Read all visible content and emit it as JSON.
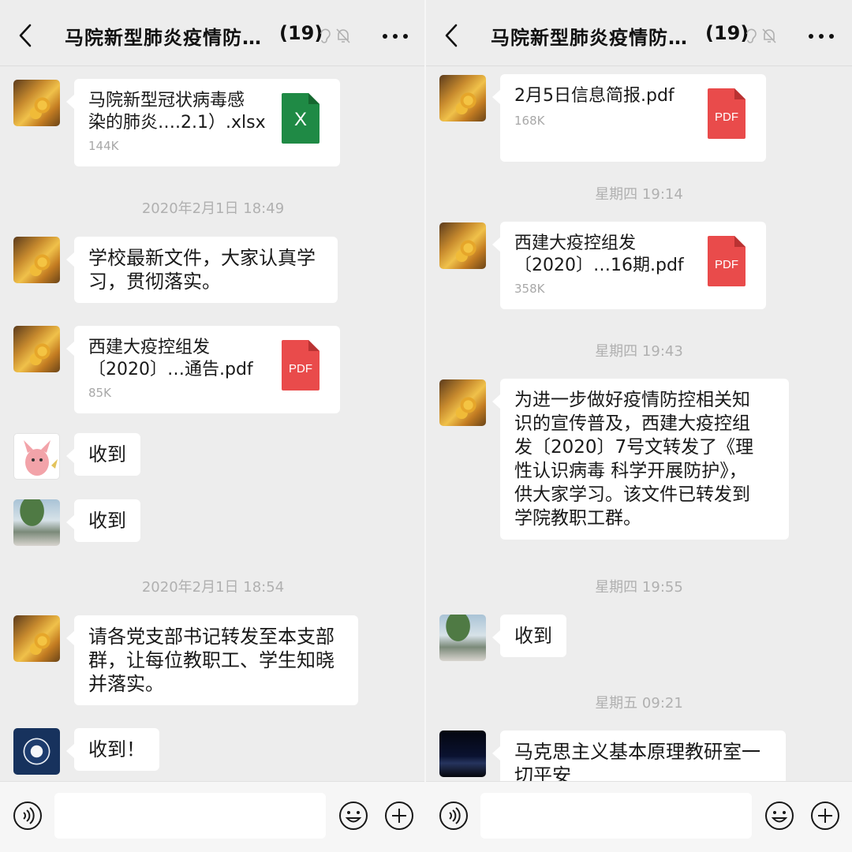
{
  "colors": {
    "background": "#ededed",
    "bubble": "#ffffff",
    "timestamp": "#b0b0b0",
    "pdf_icon": "#e94b4b",
    "excel_icon": "#1f8a45"
  },
  "chat": {
    "title": "马院新型肺炎疫情防…",
    "member_count": "(19)"
  },
  "left_screen": {
    "messages": [
      {
        "type": "file",
        "avatar": "bear-avatar",
        "file_name": "马院新型冠状病毒感\n染的肺炎….2.1）.xlsx",
        "file_size": "144K",
        "file_icon": "excel-icon",
        "icon_label": "X"
      },
      {
        "type": "timestamp",
        "text": "2020年2月1日 18:49"
      },
      {
        "type": "text",
        "avatar": "bear-avatar",
        "text": "学校最新文件，大家认真学\n习，贯彻落实。"
      },
      {
        "type": "file",
        "avatar": "bear-avatar",
        "file_name": "西建大疫控组发\n〔2020〕…通告.pdf",
        "file_size": "85K",
        "file_icon": "pdf-icon",
        "icon_label": "PDF"
      },
      {
        "type": "text",
        "avatar": "pink-cartoon-avatar",
        "text": "收到"
      },
      {
        "type": "text",
        "avatar": "tree-avatar",
        "text": "收到"
      },
      {
        "type": "timestamp",
        "text": "2020年2月1日 18:54"
      },
      {
        "type": "text",
        "avatar": "bear-avatar",
        "text": "请各党支部书记转发至本支部\n群，让每位教职工、学生知晓\n并落实。"
      },
      {
        "type": "text",
        "avatar": "fish-logo-avatar",
        "text": "收到！"
      }
    ]
  },
  "right_screen": {
    "messages": [
      {
        "type": "file",
        "avatar": "bear-avatar",
        "file_name": "2月5日信息简报.pdf",
        "file_size": "168K",
        "file_icon": "pdf-icon",
        "icon_label": "PDF"
      },
      {
        "type": "timestamp",
        "text": "星期四 19:14"
      },
      {
        "type": "file",
        "avatar": "bear-avatar",
        "file_name": "西建大疫控组发\n〔2020〕…16期.pdf",
        "file_size": "358K",
        "file_icon": "pdf-icon",
        "icon_label": "PDF"
      },
      {
        "type": "timestamp",
        "text": "星期四 19:43"
      },
      {
        "type": "text",
        "avatar": "bear-avatar",
        "text": " 为进一步做好疫情防控相关知\n识的宣传普及，西建大疫控组\n发〔2020〕7号文转发了《理\n性认识病毒 科学开展防护》，\n供大家学习。该文件已转发到\n学院教职工群。"
      },
      {
        "type": "timestamp",
        "text": "星期四 19:55"
      },
      {
        "type": "text",
        "avatar": "tree-avatar",
        "text": "收到"
      },
      {
        "type": "timestamp",
        "text": "星期五 09:21"
      },
      {
        "type": "text",
        "avatar": "night-city-avatar",
        "text": "马克思主义基本原理教研室一\n切平安"
      }
    ]
  }
}
